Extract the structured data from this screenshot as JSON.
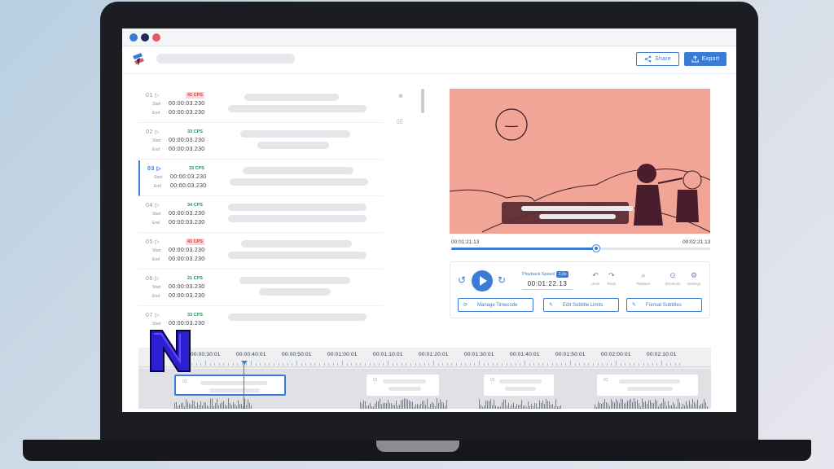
{
  "header": {
    "share_label": "Share",
    "export_label": "Export"
  },
  "window_dots": [
    "#3a7bd5",
    "#1f2a5c",
    "#e85a5a"
  ],
  "colors": {
    "accent": "#3a7bd5",
    "video_bg": "#f2a596",
    "cps_red": "#d04545",
    "cps_green": "#2f8f5a"
  },
  "subtitles": [
    {
      "num": "01",
      "cps": "41 CPS",
      "cps_state": "red",
      "start": "00:00:03.230",
      "end": "00:00:03.230",
      "active": false
    },
    {
      "num": "02",
      "cps": "33 CPS",
      "cps_state": "green",
      "start": "00:00:03.230",
      "end": "00:00:03.230",
      "active": false
    },
    {
      "num": "03",
      "cps": "33 CPS",
      "cps_state": "green",
      "start": "00:00:03.230",
      "end": "00:00:03.230",
      "active": true
    },
    {
      "num": "04",
      "cps": "34 CPS",
      "cps_state": "green",
      "start": "00:00:03.230",
      "end": "00:00:03.230",
      "active": false
    },
    {
      "num": "05",
      "cps": "41 CPS",
      "cps_state": "red",
      "start": "00:00:03.230",
      "end": "00:00:03.230",
      "active": false
    },
    {
      "num": "06",
      "cps": "21 CPS",
      "cps_state": "green",
      "start": "00:00:03.230",
      "end": "00:00:03.230",
      "active": false
    },
    {
      "num": "07",
      "cps": "33 CPS",
      "cps_state": "green",
      "start": "00:00:03.230",
      "end": "",
      "active": false
    }
  ],
  "labels": {
    "start": "Start",
    "end": "End"
  },
  "player": {
    "current_time": "00:01:21:13",
    "total_time": "00:02:21:13",
    "progress": 0.56,
    "playback_speed_label": "Playback Speed",
    "playback_speed_value": "1.0x",
    "timecode": "00:01:22.13"
  },
  "tools": [
    {
      "icon": "undo-icon",
      "label": "Undo"
    },
    {
      "icon": "redo-icon",
      "label": "Redo"
    },
    {
      "icon": "search-icon",
      "label": "Replace"
    },
    {
      "icon": "shortcuts-icon",
      "label": "Shortcuts"
    },
    {
      "icon": "settings-icon",
      "label": "Settings"
    }
  ],
  "actions": {
    "manage_timecode": "Manage Timecode",
    "edit_subtitle_limits": "Edit Subtitle Limits",
    "format_subtitles": "Format Subtitles"
  },
  "timeline": {
    "ticks": [
      "00:00:30:01",
      "00:00:40:01",
      "00:00:50:01",
      "00:01:00:01",
      "00:01:10:01",
      "00:01:20:01",
      "00:01:30:01",
      "00:01:40:01",
      "00:01:50:01",
      "00:02:00:01",
      "00:02:10:01"
    ],
    "clips": [
      {
        "num": "01",
        "selected": true
      },
      {
        "num": "01",
        "selected": false
      },
      {
        "num": "01",
        "selected": false
      },
      {
        "num": "01",
        "selected": false
      }
    ]
  }
}
